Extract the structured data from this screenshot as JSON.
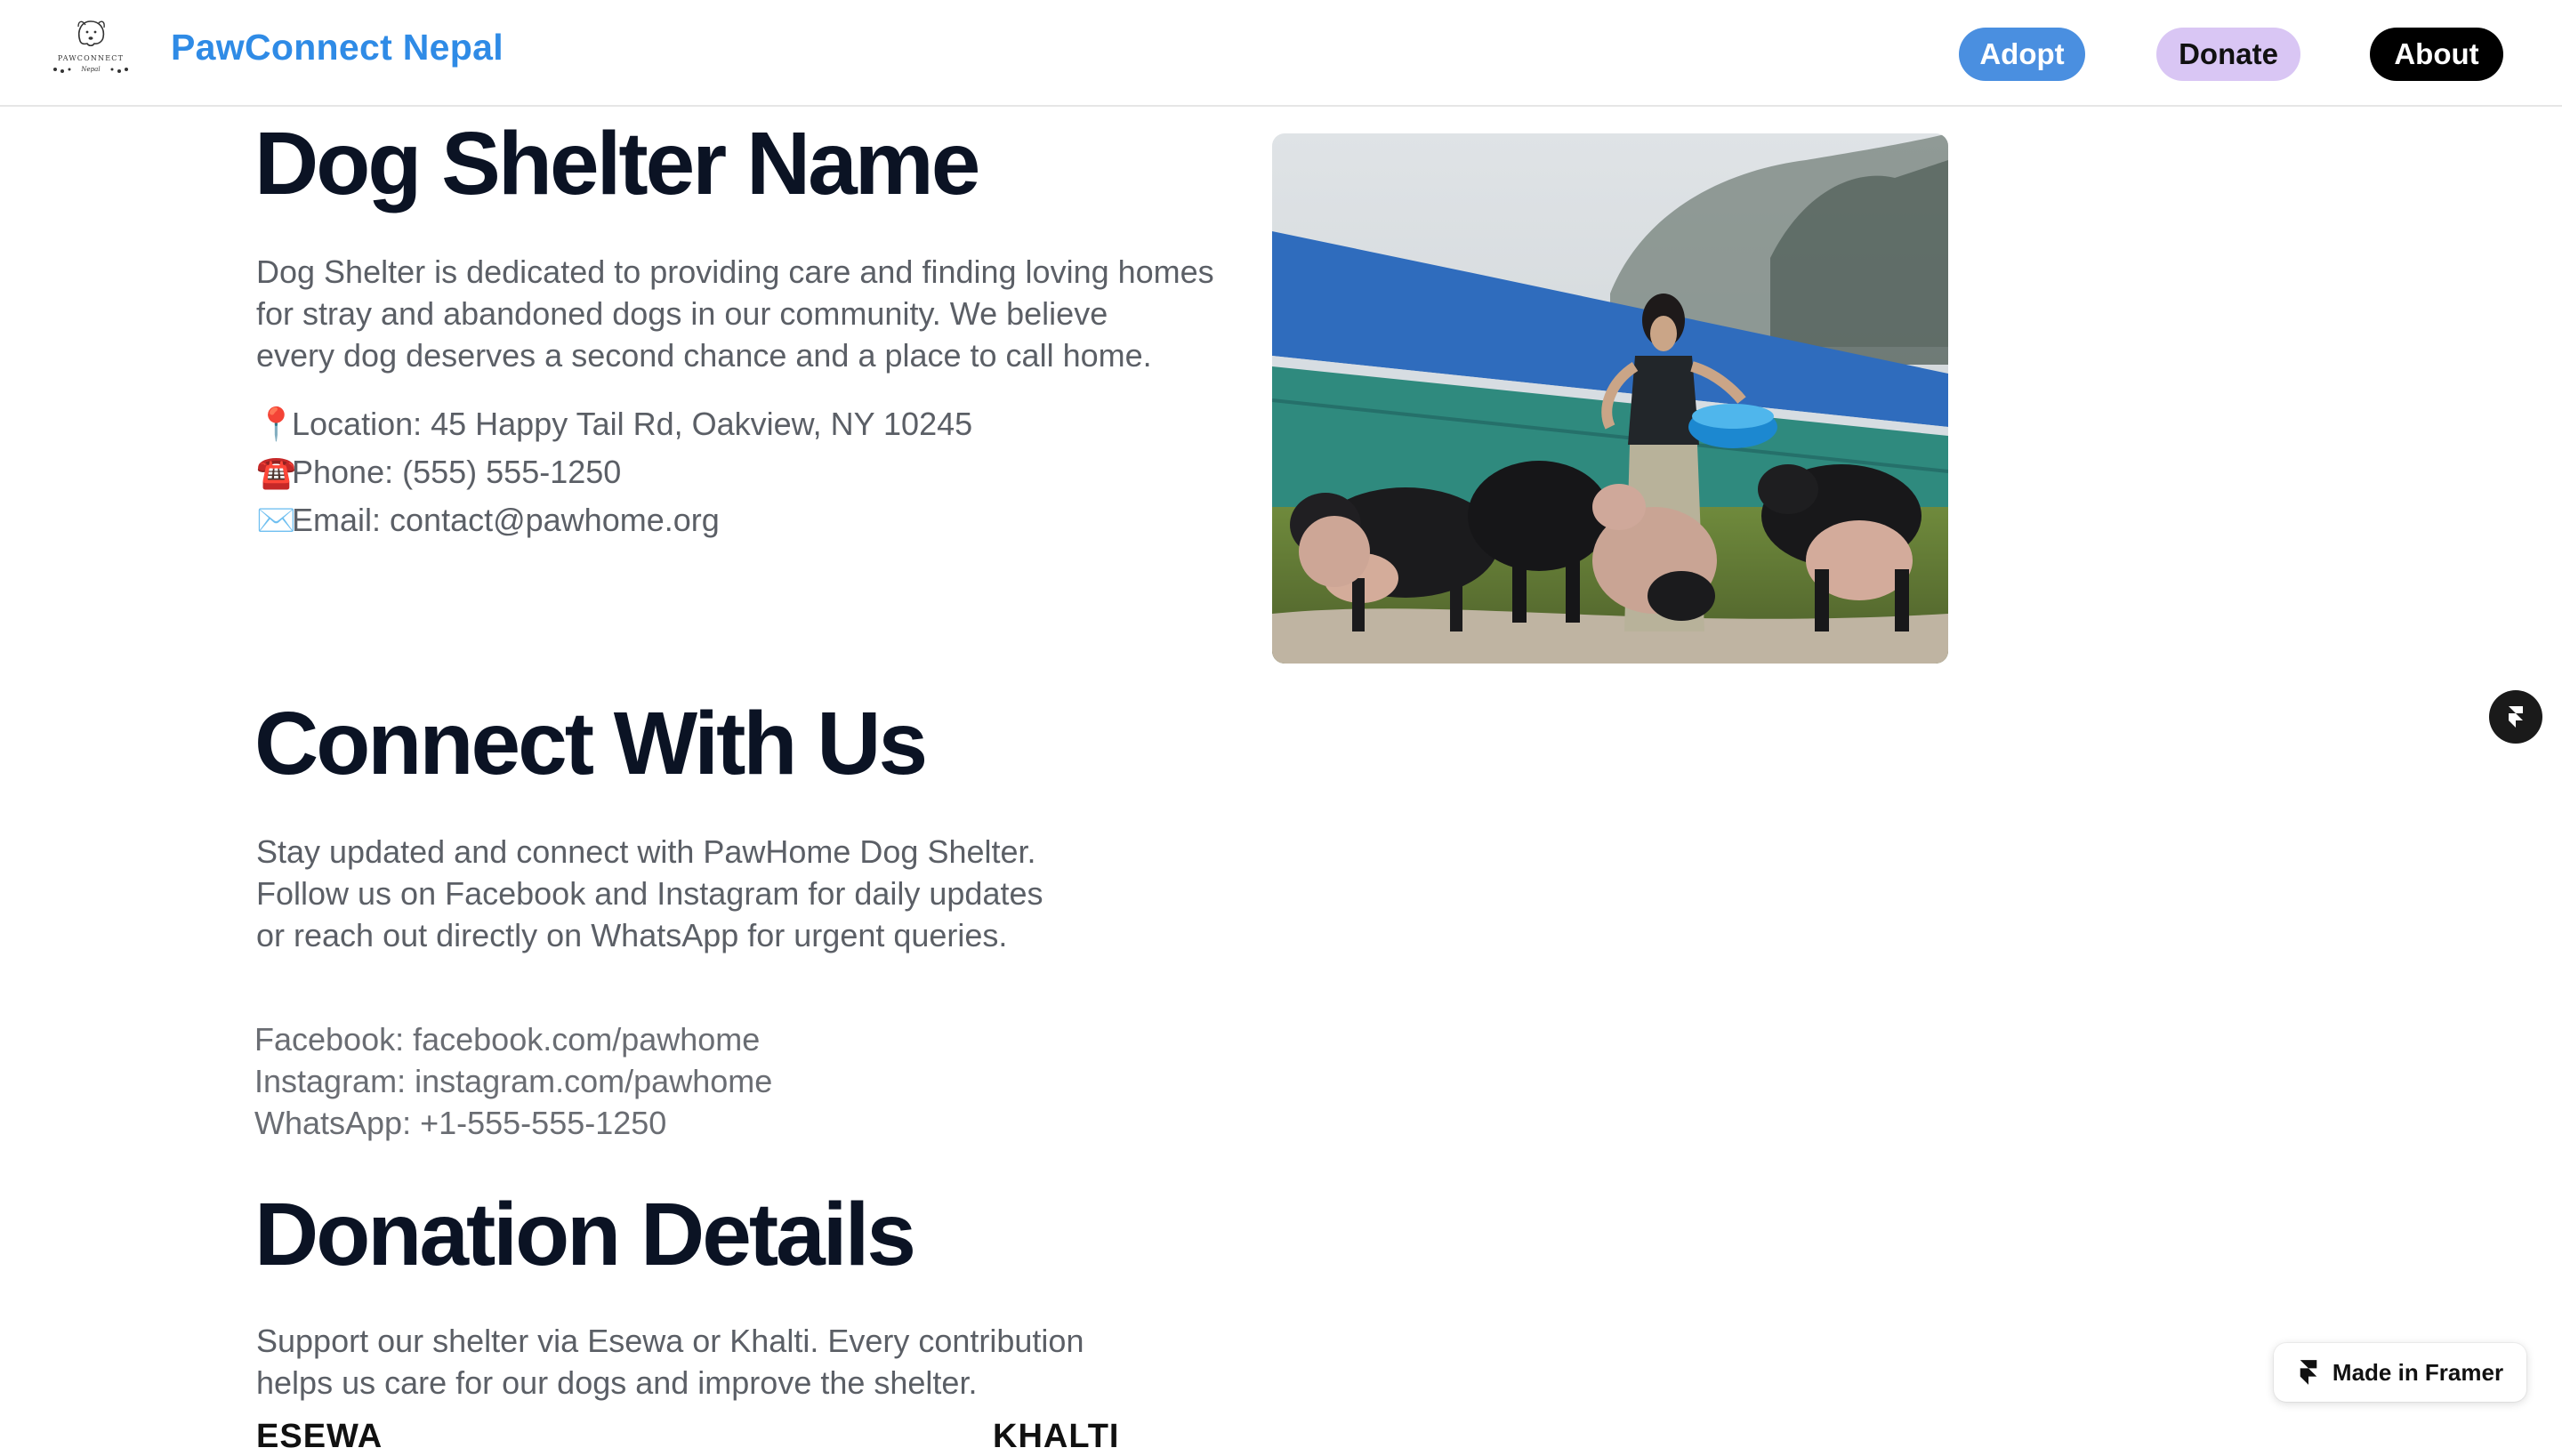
{
  "header": {
    "brand": "PawConnect Nepal",
    "logo_text": "PAWCONNECT",
    "logo_subtext": "Nepal",
    "nav": {
      "adopt": "Adopt",
      "donate": "Donate",
      "about": "About"
    }
  },
  "shelter": {
    "title": "Dog Shelter Name",
    "description_lines": [
      "Dog Shelter is dedicated to providing care and finding loving homes",
      "for stray and abandoned dogs in our community. We believe",
      "every dog deserves a second chance and a place to call home."
    ],
    "location": "Location: 45 Happy Tail Rd, Oakview, NY 10245",
    "phone": "Phone: (555) 555-1250",
    "email": "Email: contact@pawhome.org",
    "icons": {
      "location": "📍",
      "phone": "☎️",
      "email": "✉️"
    }
  },
  "connect": {
    "title": "Connect With Us",
    "description_lines": [
      "Stay updated and connect with PawHome Dog Shelter.",
      "Follow us on Facebook and Instagram for daily updates",
      "or reach out directly on WhatsApp for urgent queries."
    ],
    "facebook": "Facebook: facebook.com/pawhome",
    "instagram": "Instagram: instagram.com/pawhome",
    "whatsapp": "WhatsApp: +1-555-555-1250"
  },
  "donation": {
    "title": "Donation Details",
    "description_lines": [
      "Support our shelter via Esewa or Khalti. Every contribution",
      "helps us care for our dogs and improve the shelter."
    ],
    "esewa_label": "ESEWA",
    "khalti_label": "KHALTI"
  },
  "framer_badge": "Made in Framer",
  "colors": {
    "brand": "#2f8be6",
    "adopt_bg": "#4a8fe0",
    "donate_bg": "#d9c6f4",
    "about_bg": "#000000",
    "heading": "#0b1324",
    "body_text": "#5b5f66"
  }
}
